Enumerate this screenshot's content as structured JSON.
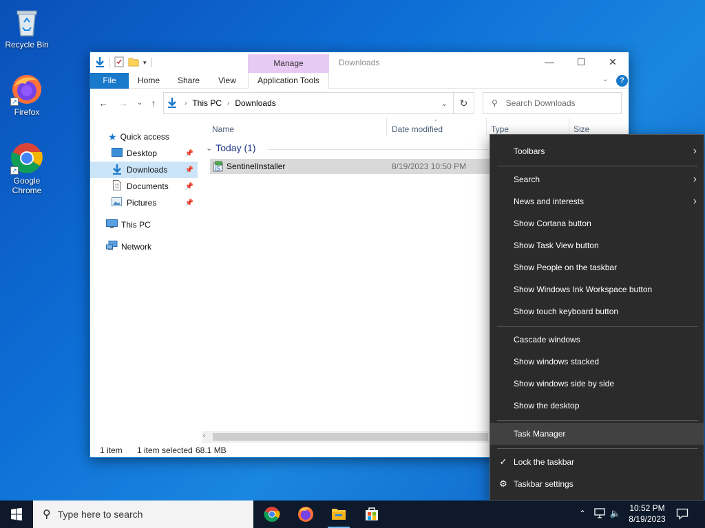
{
  "desktop": {
    "icons": [
      {
        "label": "Recycle Bin"
      },
      {
        "label": "Firefox"
      },
      {
        "label": "Google Chrome"
      }
    ]
  },
  "explorer": {
    "title": "Downloads",
    "manage_tab": "Manage",
    "ribbon_tabs": {
      "file": "File",
      "home": "Home",
      "share": "Share",
      "view": "View",
      "app_tools": "Application Tools"
    },
    "breadcrumb": [
      "This PC",
      "Downloads"
    ],
    "search_placeholder": "Search Downloads",
    "nav": {
      "quick_access": "Quick access",
      "desktop": "Desktop",
      "downloads": "Downloads",
      "documents": "Documents",
      "pictures": "Pictures",
      "this_pc": "This PC",
      "network": "Network"
    },
    "columns": {
      "name": "Name",
      "date": "Date modified",
      "type": "Type",
      "size": "Size"
    },
    "group_label": "Today (1)",
    "files": [
      {
        "name": "SentinelInstaller",
        "date": "8/19/2023 10:50 PM"
      }
    ],
    "status": {
      "count": "1 item",
      "selected": "1 item selected",
      "size": "68.1 MB"
    }
  },
  "context_menu": {
    "items": {
      "toolbars": "Toolbars",
      "search": "Search",
      "news": "News and interests",
      "cortana": "Show Cortana button",
      "taskview": "Show Task View button",
      "people": "Show People on the taskbar",
      "ink": "Show Windows Ink Workspace button",
      "touchkb": "Show touch keyboard button",
      "cascade": "Cascade windows",
      "stacked": "Show windows stacked",
      "sidebyside": "Show windows side by side",
      "desktop": "Show the desktop",
      "taskmgr": "Task Manager",
      "lock": "Lock the taskbar",
      "settings": "Taskbar settings"
    }
  },
  "taskbar": {
    "search_placeholder": "Type here to search",
    "time": "10:52 PM",
    "date": "8/19/2023"
  },
  "colors": {
    "accent": "#1979ca",
    "manage_tab": "#e8c9f3",
    "menu_bg": "#2b2b2b",
    "taskbar": "#0e1a2b"
  }
}
